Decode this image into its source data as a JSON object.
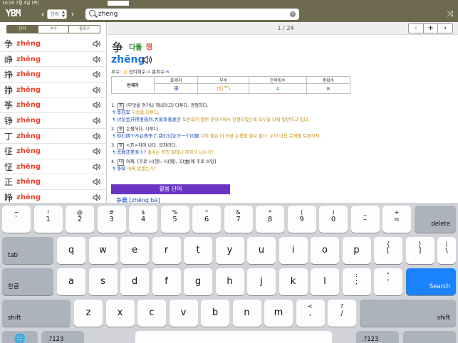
{
  "status": {
    "time": "10:20",
    "date": "7월 4일 (목)"
  },
  "toolbar": {
    "logo": "YBM",
    "dict_label": "단어",
    "search_value": "zheng",
    "prev_symbol": "‹",
    "next_symbol": "›",
    "shuffle_symbol": "⤨",
    "clear_symbol": "×"
  },
  "left": {
    "tabs": [
      "단어",
      "부수",
      "총획수"
    ],
    "words": [
      {
        "hanzi": "争",
        "pinyin": "zhēng"
      },
      {
        "hanzi": "峥",
        "pinyin": "zhēng"
      },
      {
        "hanzi": "挣",
        "pinyin": "zhēng"
      },
      {
        "hanzi": "狰",
        "pinyin": "zhēng"
      },
      {
        "hanzi": "筝",
        "pinyin": "zhēng"
      },
      {
        "hanzi": "铮",
        "pinyin": "zhēng"
      },
      {
        "hanzi": "丁",
        "pinyin": "zhēng"
      },
      {
        "hanzi": "征",
        "pinyin": "zhēng"
      },
      {
        "hanzi": "怔",
        "pinyin": "zhēng"
      },
      {
        "hanzi": "正",
        "pinyin": "zhēng"
      },
      {
        "hanzi": "睁",
        "pinyin": "zhēng"
      }
    ]
  },
  "right": {
    "counter": "1 / 24",
    "nav_buttons": [
      "‹",
      "+",
      "›"
    ],
    "entry": {
      "hanzi": "争",
      "korean_reading": "다툴",
      "korean_sound": "쟁",
      "pinyin": "zhēng",
      "meta": {
        "radical_label": "부수:",
        "radical": "刀",
        "remaining_label": "잔여획수:",
        "remaining": "4",
        "total_label": "총획수:",
        "total": "6"
      },
      "table": {
        "row_label": "번체자",
        "headers": [
          "표제자",
          "부수",
          "잔여획수",
          "총획수"
        ],
        "values": [
          "爭",
          "爪(爫)",
          "4",
          "8"
        ]
      },
      "definitions": {
        "d1": {
          "num": "1.",
          "pos": "동",
          "text": "(무엇을 얻거나 해내려고) 다투다. 경쟁하다."
        },
        "d1e1": {
          "mark": "¶",
          "zh": "争冠军",
          "kr": "우승을 다투다."
        },
        "d1e2": {
          "mark": "¶",
          "zh": "讨论会开得很热烈,大家争着发言",
          "kr": "토론회가 열띤 분위기에서 진행되었는데 모두들 다퉈 발언하고 있다."
        },
        "d2": {
          "num": "2.",
          "pos": "동",
          "text": "논쟁하다. 다투다."
        },
        "d2e1": {
          "mark": "¶",
          "zh": "你们两个不必再争了,我们讨论下一个问题",
          "kr": "너희 둘은 더 이상 논쟁할 필요 없다. 우리 다음 문제를 토론하자."
        },
        "d3": {
          "num": "3.",
          "pos": "형",
          "text": "<方>차이 나다. 모자라다."
        },
        "d3e1": {
          "mark": "¶",
          "zh": "总数还差多少?",
          "kr": "총수는 아직 얼마나 차이가 나는가?"
        },
        "d4": {
          "num": "4.",
          "pos": "대",
          "text": "어찌. [주로 시(詩), 사(詞), 곡(曲)에 주로 쓰임]"
        },
        "d4e1": {
          "mark": "¶",
          "zh": "争知",
          "kr": "어찌 알겠는가?"
        }
      },
      "usage_button": "활용 단어",
      "usage_first": "争霸 [zhēng bà]"
    }
  },
  "keyboard": {
    "row1": [
      {
        "top": "~",
        "bottom": "`"
      },
      {
        "top": "!",
        "bottom": "1"
      },
      {
        "top": "@",
        "bottom": "2"
      },
      {
        "top": "#",
        "bottom": "3"
      },
      {
        "top": "$",
        "bottom": "4"
      },
      {
        "top": "%",
        "bottom": "5"
      },
      {
        "top": "^",
        "bottom": "6"
      },
      {
        "top": "&",
        "bottom": "7"
      },
      {
        "top": "*",
        "bottom": "8"
      },
      {
        "top": "(",
        "bottom": "9"
      },
      {
        "top": ")",
        "bottom": "0"
      },
      {
        "top": "_",
        "bottom": "–"
      },
      {
        "top": "+",
        "bottom": "="
      }
    ],
    "delete": "delete",
    "tab": "tab",
    "row2": [
      "q",
      "w",
      "e",
      "r",
      "t",
      "y",
      "u",
      "i",
      "o",
      "p"
    ],
    "row2_extra": [
      {
        "top": "{",
        "bottom": "["
      },
      {
        "top": "}",
        "bottom": "]"
      },
      {
        "top": "|",
        "bottom": "\\"
      }
    ],
    "lang": "한글",
    "row3": [
      "a",
      "s",
      "d",
      "f",
      "g",
      "h",
      "j",
      "k",
      "l"
    ],
    "row3_extra": [
      {
        "top": ":",
        "bottom": ";"
      },
      {
        "top": "\"",
        "bottom": "'"
      }
    ],
    "search": "Search",
    "shift": "shift",
    "row4": [
      "z",
      "x",
      "c",
      "v",
      "b",
      "n",
      "m"
    ],
    "row4_extra": [
      {
        "top": "!",
        "bottom": ","
      },
      {
        "top": "?",
        "bottom": "."
      },
      {
        "top": "?",
        "bottom": "/"
      }
    ],
    "row4_extra_alt": [
      {
        "top": "<",
        "bottom": ","
      },
      {
        "top": "?",
        "bottom": "/"
      }
    ],
    "globe": "🌐",
    "num": ".?123"
  }
}
